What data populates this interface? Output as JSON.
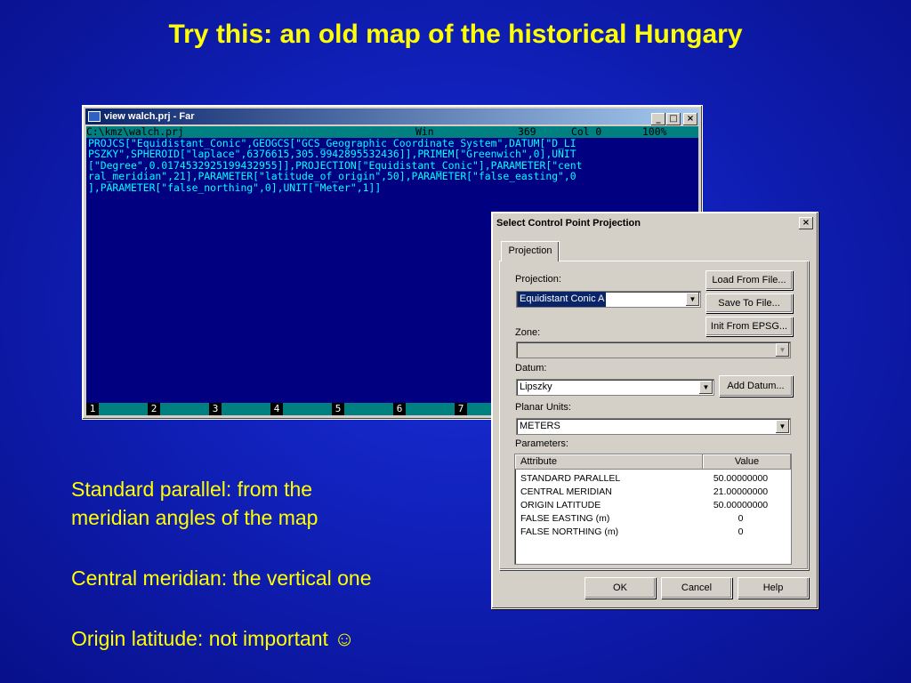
{
  "slide": {
    "title": "Try this: an old map of the historical Hungary",
    "notes": [
      [
        "Standard parallel: from the",
        "meridian angles of the map"
      ],
      [
        "Central meridian: the vertical one"
      ],
      [
        "Origin latitude: not important ☺"
      ]
    ]
  },
  "far_window": {
    "title": "view walch.prj - Far",
    "buttons": {
      "minimize": "_",
      "maximize": "□",
      "close": "×"
    },
    "status": {
      "path": "C:\\kmz\\walch.prj",
      "encoding": "Win",
      "size": "369",
      "col": "Col 0",
      "percent": "100%"
    },
    "content_lines": [
      "PROJCS[\"Equidistant_Conic\",GEOGCS[\"GCS_Geographic Coordinate System\",DATUM[\"D_LI",
      "PSZKY\",SPHEROID[\"laplace\",6376615,305.9942895532436]],PRIMEM[\"Greenwich\",0],UNIT",
      "[\"Degree\",0.0174532925199432955]],PROJECTION[\"Equidistant_Conic\"],PARAMETER[\"cent",
      "ral_meridian\",21],PARAMETER[\"latitude_of_origin\",50],PARAMETER[\"false_easting\",0",
      "],PARAMETER[\"false_northing\",0],UNIT[\"Meter\",1]]"
    ],
    "function_keys": [
      "1",
      "2",
      "3",
      "4",
      "5",
      "6",
      "7"
    ]
  },
  "dialog": {
    "title": "Select Control Point Projection",
    "close": "×",
    "tab": "Projection",
    "projection_label": "Projection:",
    "projection_value": "Equidistant Conic A",
    "load_button": "Load From File...",
    "save_button": "Save To File...",
    "epsg_button": "Init From EPSG...",
    "zone_label": "Zone:",
    "zone_value": "",
    "datum_label": "Datum:",
    "datum_value": "Lipszky",
    "add_datum_button": "Add Datum...",
    "planar_units_label": "Planar Units:",
    "planar_units_value": "METERS",
    "parameters_label": "Parameters:",
    "parameters_columns": [
      "Attribute",
      "Value"
    ],
    "parameters": [
      [
        "STANDARD PARALLEL",
        "50.00000000"
      ],
      [
        "CENTRAL MERIDIAN",
        "21.00000000"
      ],
      [
        "ORIGIN LATITUDE",
        "50.00000000"
      ],
      [
        "FALSE EASTING (m)",
        "0"
      ],
      [
        "FALSE NORTHING (m)",
        "0"
      ]
    ],
    "ok_button": "OK",
    "cancel_button": "Cancel",
    "help_button": "Help"
  }
}
